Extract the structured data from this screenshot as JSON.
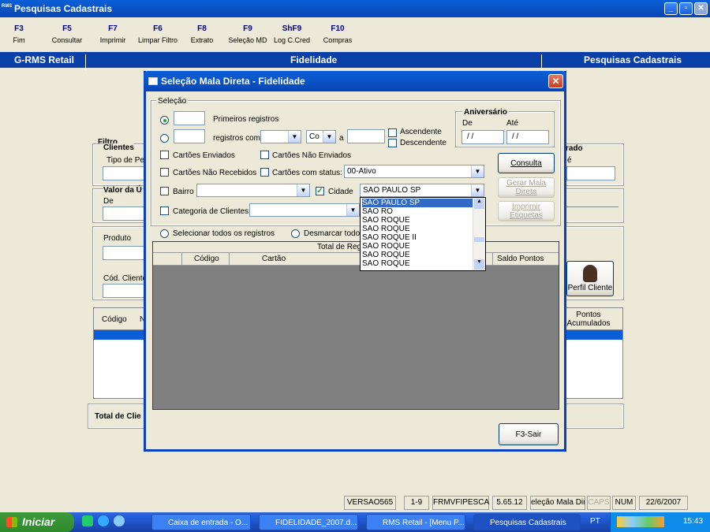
{
  "window": {
    "title": "Pesquisas Cadastrais",
    "logo": "RMS"
  },
  "toolbar": [
    {
      "key": "F3",
      "label": "Fim"
    },
    {
      "key": "F5",
      "label": "Consultar"
    },
    {
      "key": "F7",
      "label": "Imprimir"
    },
    {
      "key": "F6",
      "label": "Limpar Filtro"
    },
    {
      "key": "F8",
      "label": "Extrato"
    },
    {
      "key": "F9",
      "label": "Seleção MD"
    },
    {
      "key": "ShF9",
      "label": "Log C.Cred"
    },
    {
      "key": "F10",
      "label": "Compras"
    }
  ],
  "band": {
    "left": "G-RMS Retail",
    "center": "Fidelidade",
    "right": "Pesquisas Cadastrais"
  },
  "background_form": {
    "filtro": "Filtro",
    "clientes": "Clientes",
    "tipo_pes": "Tipo de Pes",
    "valor": "Valor da Ú",
    "de": "De",
    "produto": "Produto",
    "cod_cliente": "Cód. Cliente",
    "rado": "rado",
    "e_label": "é",
    "perfil_cliente": "Perfil Cliente",
    "table_codigo": "Código",
    "table_n": "N",
    "pontos_acumulados": "Pontos\nAcumulados",
    "total_clientes": "Total de Clie"
  },
  "dialog": {
    "title": "Seleção Mala Direta - Fidelidade",
    "selecao": "Seleção",
    "primeiros_registros": "Primeiros registros",
    "registros_com": "registros com",
    "op_value": "Co",
    "a_label": "a",
    "ascendente": "Ascendente",
    "descendente": "Descendente",
    "aniversario": "Aniversário",
    "ate": "Até",
    "de": "De",
    "date_de": "/ /",
    "date_ate": "/ /",
    "cartoes_enviados": "Cartões Enviados",
    "cartoes_nao_enviados": "Cartões Não Enviados",
    "cartoes_nao_recebidos": "Cartões Não Recebidos",
    "cartoes_com_status": "Cartões com status:",
    "status_value": "00-Ativo",
    "bairro": "Bairro",
    "cidade": "Cidade",
    "cidade_value": "SAO PAULO SP",
    "categoria": "Categoria de Clientes",
    "selecionar_todos": "Selecionar todos os registros",
    "desmarcar_todos": "Desmarcar todos",
    "total_reg": "Total de Reg",
    "col_codigo": "Código",
    "col_cartao": "Cartão",
    "col_saldo": "Saldo Pontos",
    "btn_consulta": "Consulta",
    "btn_gerar": "Gerar Mala Direta",
    "btn_imprimir": "Imprimir Etiquetas",
    "btn_sair": "F3-Sair"
  },
  "city_dropdown": [
    "SAO PAULO SP",
    "SAO RO",
    "SAO ROQUE",
    "SAO ROQUE",
    "SAO ROQUE II",
    "SAO ROQUE",
    "SAO ROQUE",
    "SAO ROQUE"
  ],
  "statusbar": {
    "version": "VERSAO565",
    "pages": "1-9",
    "form": "FRMVFIPESCA",
    "build": "5.65.12",
    "screen": "eleção Mala Dire",
    "caps": "CAPS",
    "num": "NUM",
    "date": "22/6/2007"
  },
  "taskbar": {
    "start": "Iniciar",
    "tasks": [
      "Caixa de entrada - O...",
      "FIDELIDADE_2007.d...",
      "RMS Retail - [Menu P...",
      "Pesquisas Cadastrais"
    ],
    "lang": "PT",
    "clock": "15:43"
  }
}
